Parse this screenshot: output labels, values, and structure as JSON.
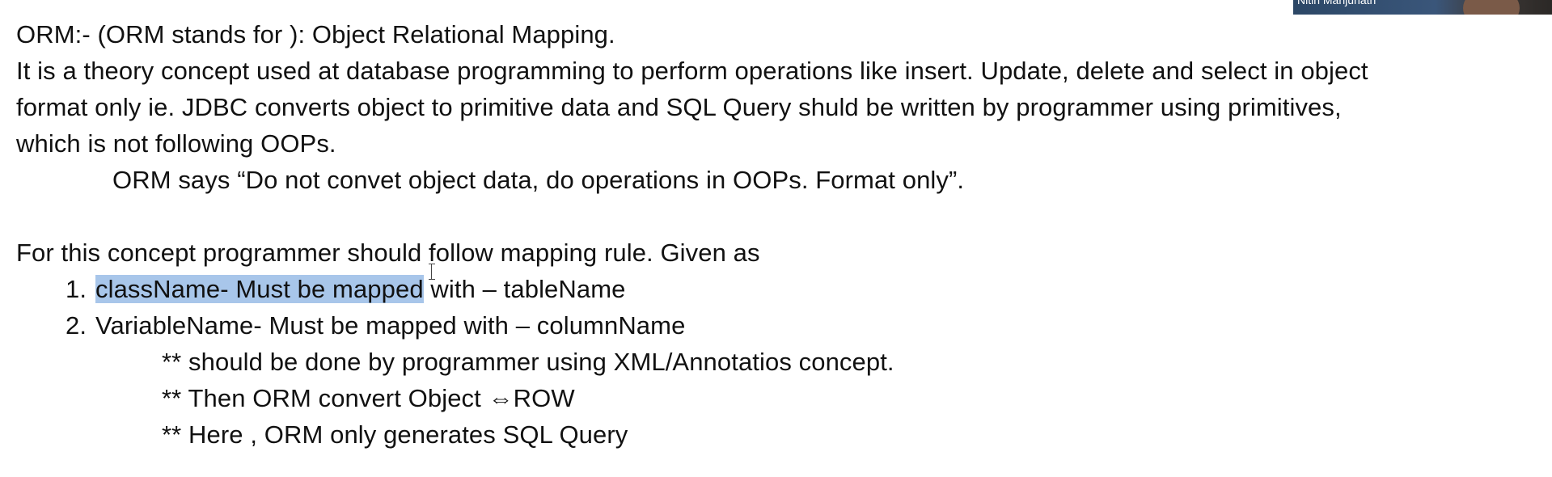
{
  "document": {
    "lines": [
      "ORM:- (ORM stands for ): Object Relational Mapping.",
      "It is a theory concept used at database programming to perform operations like insert. Update, delete and select in object",
      "format only ie. JDBC converts object to primitive data and SQL Query shuld be written by programmer using primitives,",
      "which is not following OOPs.",
      "ORM says “Do not convet object data, do operations in OOPs. Format only”.",
      "For this concept programmer should follow mapping rule. Given as"
    ],
    "list": [
      {
        "number": "1.",
        "selected_text": "className- Must be mapped",
        "rest_text": " with – tableName"
      },
      {
        "number": "2.",
        "selected_text": "",
        "rest_text": "VariableName- Must be mapped with – columnName"
      }
    ],
    "notes": [
      "** should be done by programmer using XML/Annotatios concept.",
      "** Then ORM convert Object ⇔ROW",
      "** Here , ORM only generates SQL Query"
    ]
  },
  "video_overlay": {
    "participant_name": "Nitin Manjunath"
  },
  "colors": {
    "selection": "#a8c6ea",
    "text": "#111111",
    "background": "#ffffff"
  }
}
